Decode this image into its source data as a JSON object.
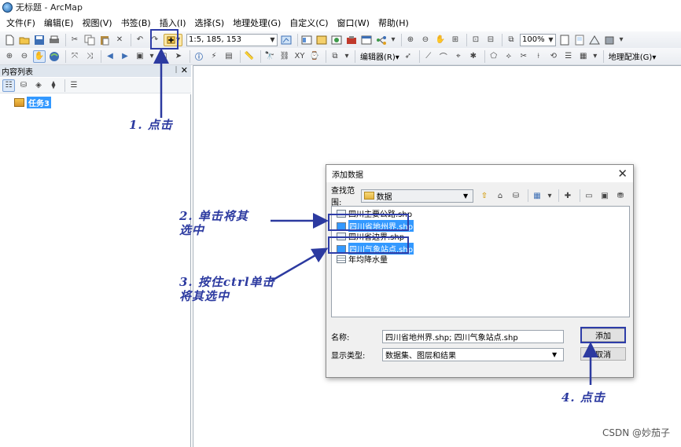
{
  "window": {
    "title": "无标题 - ArcMap"
  },
  "menu": [
    "文件(F)",
    "编辑(E)",
    "视图(V)",
    "书签(B)",
    "插入(I)",
    "选择(S)",
    "地理处理(G)",
    "自定义(C)",
    "窗口(W)",
    "帮助(H)"
  ],
  "toolbar": {
    "scale": "1:5, 185, 153",
    "zoom": "100%",
    "editor_label": "编辑器(R)▾",
    "georef_label": "地理配准(G)▾"
  },
  "toc": {
    "title": "内容列表",
    "pin": "ꟷ",
    "close": "✕",
    "layer_name": "任务3"
  },
  "dialog": {
    "title": "添加数据",
    "look_in_label": "查找范围:",
    "look_in_value": "数据",
    "files": [
      "四川主要公路.shp",
      "四川省地州界.shp",
      "四川省边界.shp",
      "四川气象站点.shp",
      "年均降水量"
    ],
    "name_label": "名称:",
    "name_value": "四川省地州界.shp; 四川气象站点.shp",
    "type_label": "显示类型:",
    "type_value": "数据集、图层和结果",
    "add_button": "添加",
    "cancel_button": "取消"
  },
  "annotations": {
    "step1": "1. 点击",
    "step2": "2. 单击将其\n选中",
    "step3": "3. 按住ctrl单击\n将其选中",
    "step4": "4. 点击"
  },
  "watermark": "CSDN @妙茄子",
  "colors": {
    "annotation": "#2c3aa0",
    "selection": "#3399ff"
  }
}
